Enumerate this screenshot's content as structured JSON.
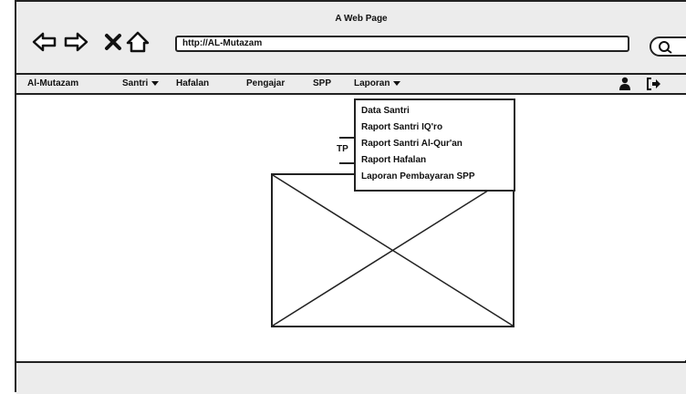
{
  "window": {
    "title": "A Web Page",
    "url": "http://AL-Mutazam"
  },
  "menu": {
    "brand": "Al-Mutazam",
    "items": [
      {
        "label": "Santri",
        "has_caret": true
      },
      {
        "label": "Hafalan",
        "has_caret": false
      },
      {
        "label": "Pengajar",
        "has_caret": false
      },
      {
        "label": "SPP",
        "has_caret": false
      },
      {
        "label": "Laporan",
        "has_caret": true
      }
    ]
  },
  "dropdown": {
    "items": [
      "Data Santri",
      "Raport Santri IQ'ro",
      "Raport Santri Al-Qur'an",
      "Raport Hafalan",
      "Laporan Pembayaran SPP"
    ]
  },
  "content": {
    "partial_label": "TP"
  },
  "icons": {
    "back": "arrow-left",
    "forward": "arrow-right",
    "stop": "close",
    "home": "home",
    "user": "user",
    "logout": "sign-out"
  }
}
